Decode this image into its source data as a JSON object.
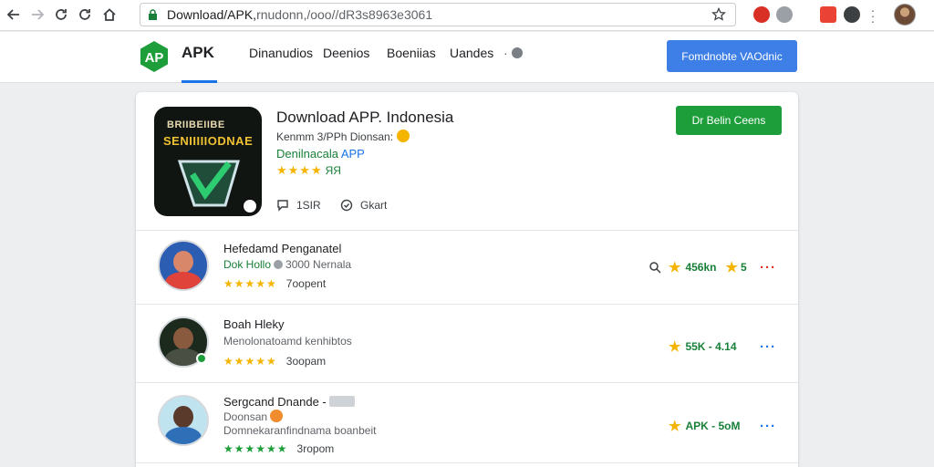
{
  "browser": {
    "url_main": "Download/APK",
    "url_rest": "rnudonn,/ooo//dR3s8963e3061"
  },
  "header": {
    "brand": "APK",
    "nav": [
      "Dinanudios",
      "Deenios",
      "Boeniias",
      "Uandes"
    ],
    "nav_extra": "·",
    "cta_label": "Fomdnobte VAOdnic"
  },
  "app": {
    "title": "Download APP. Indonesia",
    "developer": "Kenmm 3/PPh Dionsan:",
    "category_prefix": "Denilnacala",
    "category_highlight": "APP",
    "stars": "★★★★",
    "score": "ЯЯ",
    "icon_caption_1": "BRIIBEIIBE",
    "icon_caption_2": "SENIIIIIODNAE",
    "comments": "1SIR",
    "share": "Gkart",
    "download_label": "Dr Belin Ceens"
  },
  "reviews": [
    {
      "name": "Hefedamd Penganatel",
      "sub_green": "Dok Hollo",
      "sub_rest": "3000 Nernala",
      "stars": "★★★★★",
      "count": "7oopent",
      "stats": "456kn",
      "stats_2": "5"
    },
    {
      "name": "Boah Hleky",
      "sub_rest": "Menolonatoamd kenhibtos",
      "stars": "★★★★★",
      "count": "3oopam",
      "stats": "55K - 4.14"
    },
    {
      "name": "Sergcand Dnande -",
      "sub_line1": "Doonsan",
      "sub_line2": "Domnekaranfindnama boanbeit",
      "stars": "★★★★★★",
      "count": "3ropom",
      "stats": "APK - 5oM"
    }
  ],
  "colors": {
    "accent_blue": "#3d7fe6",
    "download_green": "#1e9e3a",
    "star_yellow": "#f4b400"
  }
}
